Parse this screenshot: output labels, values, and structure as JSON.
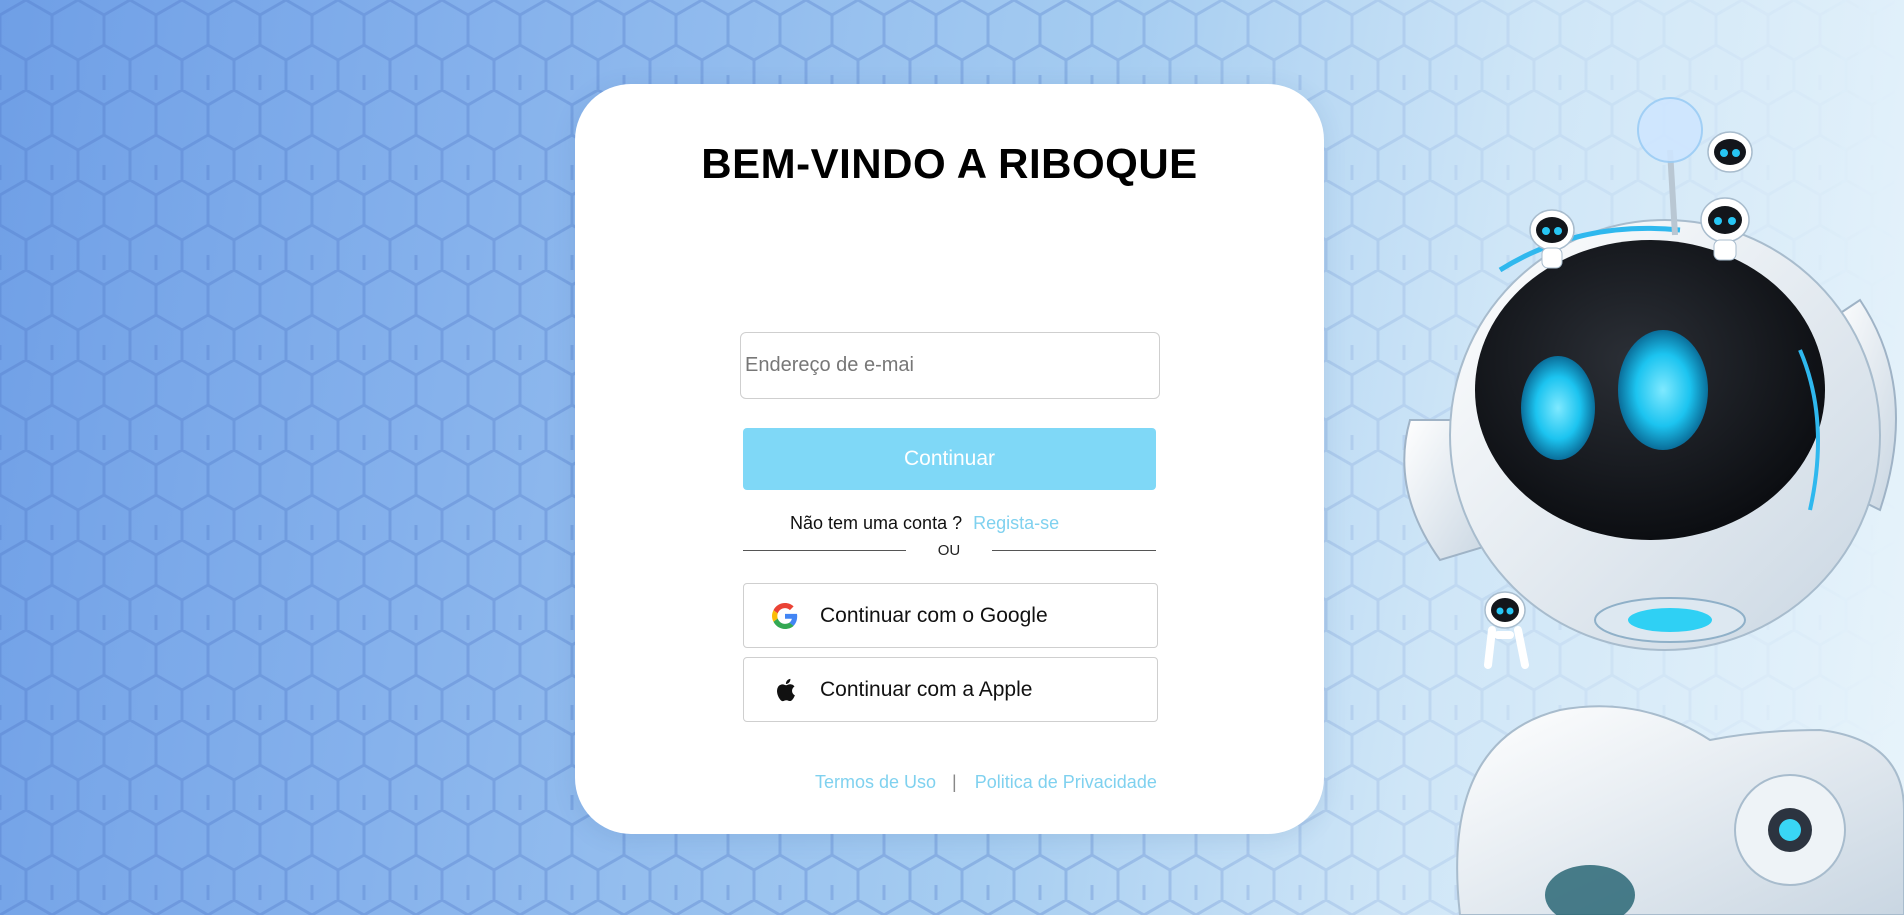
{
  "page": {
    "title": "BEM-VINDO A RIBOQUE"
  },
  "login": {
    "email_placeholder": "Endereço de e-mai",
    "email_value": "",
    "continue_label": "Continuar",
    "no_account_text": "Não tem uma conta ?",
    "signup_link": "Regista-se",
    "divider_text": "OU",
    "google_label": "Continuar com o Google",
    "apple_label": "Continuar com a Apple"
  },
  "footer": {
    "terms_link": "Termos de Uso",
    "separator": "|",
    "privacy_link": "Politica de Privacidade"
  },
  "icons": {
    "google": "google-logo-icon",
    "apple": "apple-logo-icon"
  },
  "colors": {
    "accent": "#7fd8f7",
    "link": "#7fd1ef",
    "card_background": "#ffffff",
    "page_gradient_start": "#6f9fe6",
    "page_gradient_end": "#e8f4fb"
  }
}
